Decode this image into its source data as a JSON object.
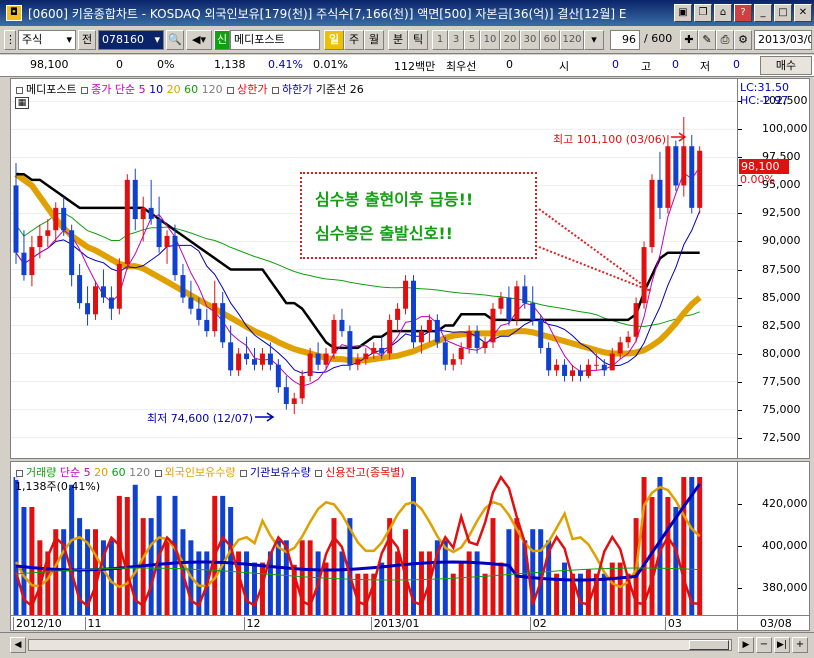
{
  "window": {
    "title": "[0600] 키움종합차트 - KOSDAQ 외국인보유[179(천)] 주식수[7,166(천)] 액면[500] 자본금[36(억)] 결산[12월] E"
  },
  "toolbar": {
    "market_type": "주식",
    "code_label": "전",
    "code": "078160",
    "stock_name_prefix": "신",
    "stock_name": "메디포스트",
    "unit_active": "일",
    "units": [
      "주",
      "월",
      "분",
      "틱"
    ],
    "tick_options": [
      "1",
      "3",
      "5",
      "10",
      "20",
      "30",
      "60",
      "120"
    ],
    "count": "96",
    "count_total": "/ 600",
    "date": "2013/03/0"
  },
  "quote": {
    "price": "98,100",
    "change": "0",
    "change_pct": "0%",
    "volume": "1,138",
    "volume_pct": "0.41%",
    "turnover_pct": "0.01%",
    "amount": "112백만",
    "best_bid_label": "최우선",
    "best_bid": "0",
    "open_label": "시",
    "open": "0",
    "high_label": "고",
    "high": "0",
    "low_label": "저",
    "low": "0",
    "buy_button": "매수"
  },
  "price_legend": {
    "name": "메디포스트",
    "close_ma": "종가 단순",
    "ma_periods": [
      "5",
      "10",
      "20",
      "60",
      "120"
    ],
    "upper_limit": "상한가",
    "lower_limit": "하한가",
    "baseline": "기준선 26"
  },
  "price_axis": {
    "lc": "LC:31.50",
    "hc": "HC:-2.97",
    "current_price": "98,100",
    "current_pct": "0.00%"
  },
  "annotation": {
    "line1": "심수봉 출현이후 급등!!",
    "line2": "심수봉은 출발신호!!",
    "high_label": "최고 101,100 (03/06)",
    "low_label": "최저 74,600 (12/07)"
  },
  "volume_legend": {
    "volume": "거래량",
    "ma": "단순",
    "periods": [
      "5",
      "20",
      "60",
      "120"
    ],
    "foreign": "외국인보유수량",
    "institution": "기관보유수량",
    "credit": "신용잔고(종목별)",
    "current": "1,138주(0.41%)"
  },
  "date_axis": {
    "labels": [
      "2012/10",
      "11",
      "12",
      "2013/01",
      "02",
      "03"
    ],
    "right_label": "03/08"
  },
  "colors": {
    "up": "#e01010",
    "down": "#1040d0",
    "ma5": "#c000c0",
    "ma10": "#0000c0",
    "ma20": "#e0a000",
    "ma60": "#10a010",
    "baseline": "#000000"
  },
  "chart_data": [
    {
      "type": "candlestick",
      "y_ticks": [
        72500,
        75000,
        77500,
        80000,
        82500,
        85000,
        87500,
        90000,
        92500,
        95000,
        97500,
        100000,
        102500
      ],
      "ylim": [
        70500,
        104500
      ],
      "x_months": [
        "2012/10",
        "11",
        "12",
        "2013/01",
        "02",
        "03"
      ],
      "ohlc": [
        [
          95000,
          97000,
          88000,
          89000
        ],
        [
          89000,
          91000,
          86500,
          87000
        ],
        [
          87000,
          90500,
          86000,
          89500
        ],
        [
          89500,
          91500,
          88500,
          90500
        ],
        [
          90500,
          92000,
          89500,
          91000
        ],
        [
          91000,
          93500,
          90000,
          93000
        ],
        [
          93000,
          94000,
          90500,
          91000
        ],
        [
          91000,
          91500,
          86000,
          87000
        ],
        [
          87000,
          88000,
          84000,
          84500
        ],
        [
          84500,
          86000,
          82500,
          83500
        ],
        [
          83500,
          86500,
          83000,
          86000
        ],
        [
          86000,
          87500,
          84500,
          85000
        ],
        [
          85000,
          86000,
          83000,
          84000
        ],
        [
          84000,
          88500,
          83500,
          88000
        ],
        [
          88000,
          96000,
          87500,
          95500
        ],
        [
          95500,
          96500,
          91000,
          92000
        ],
        [
          92000,
          94000,
          90000,
          93000
        ],
        [
          93000,
          95500,
          91500,
          92000
        ],
        [
          92000,
          94000,
          89000,
          89500
        ],
        [
          89500,
          91000,
          88000,
          90500
        ],
        [
          90500,
          91500,
          86500,
          87000
        ],
        [
          87000,
          88000,
          84500,
          85000
        ],
        [
          85000,
          86500,
          83500,
          84000
        ],
        [
          84000,
          85000,
          82500,
          83000
        ],
        [
          83000,
          84000,
          81500,
          82000
        ],
        [
          82000,
          86500,
          81500,
          84500
        ],
        [
          84500,
          85500,
          80500,
          81000
        ],
        [
          81000,
          82500,
          78000,
          78500
        ],
        [
          78500,
          80500,
          78000,
          80000
        ],
        [
          80000,
          81500,
          79000,
          79500
        ],
        [
          79500,
          80500,
          78500,
          79000
        ],
        [
          79000,
          80500,
          78500,
          80000
        ],
        [
          80000,
          81000,
          78500,
          79000
        ],
        [
          79000,
          79500,
          76500,
          77000
        ],
        [
          77000,
          78000,
          75000,
          75500
        ],
        [
          75500,
          76500,
          74600,
          76000
        ],
        [
          76000,
          78500,
          75500,
          78000
        ],
        [
          78000,
          80500,
          77500,
          80000
        ],
        [
          80000,
          81000,
          78500,
          79000
        ],
        [
          79000,
          80500,
          78500,
          80000
        ],
        [
          80000,
          83500,
          79500,
          83000
        ],
        [
          83000,
          84000,
          81500,
          82000
        ],
        [
          82000,
          82500,
          78500,
          79000
        ],
        [
          79000,
          80000,
          78500,
          79500
        ],
        [
          79500,
          80500,
          79000,
          80000
        ],
        [
          80000,
          81000,
          79500,
          80500
        ],
        [
          80500,
          81500,
          79500,
          80000
        ],
        [
          80000,
          83500,
          79500,
          83000
        ],
        [
          83000,
          84500,
          82000,
          84000
        ],
        [
          84000,
          87000,
          83500,
          86500
        ],
        [
          86500,
          87000,
          80500,
          81000
        ],
        [
          81000,
          82500,
          80000,
          82000
        ],
        [
          82000,
          83500,
          81000,
          83000
        ],
        [
          83000,
          83500,
          80500,
          81000
        ],
        [
          81000,
          81500,
          78500,
          79000
        ],
        [
          79000,
          80000,
          78500,
          79500
        ],
        [
          79500,
          81000,
          79000,
          80500
        ],
        [
          80500,
          82500,
          80000,
          82000
        ],
        [
          82000,
          82500,
          80000,
          80500
        ],
        [
          80500,
          81500,
          80000,
          81000
        ],
        [
          81000,
          84500,
          80500,
          84000
        ],
        [
          84000,
          85500,
          83500,
          85000
        ],
        [
          85000,
          86000,
          82500,
          83000
        ],
        [
          83000,
          86500,
          82500,
          86000
        ],
        [
          86000,
          87000,
          84000,
          84500
        ],
        [
          84500,
          86000,
          82500,
          83000
        ],
        [
          83000,
          83500,
          80000,
          80500
        ],
        [
          80500,
          81000,
          78000,
          78500
        ],
        [
          78500,
          79500,
          78000,
          79000
        ],
        [
          79000,
          79500,
          77500,
          78000
        ],
        [
          78000,
          79000,
          77500,
          78500
        ],
        [
          78500,
          79000,
          77500,
          78000
        ],
        [
          78000,
          79500,
          77800,
          79000
        ],
        [
          79000,
          80000,
          78500,
          79000
        ],
        [
          79000,
          79500,
          78000,
          78500
        ],
        [
          78500,
          80500,
          78500,
          80000
        ],
        [
          80000,
          81500,
          79500,
          81000
        ],
        [
          81000,
          82000,
          80500,
          81500
        ],
        [
          81500,
          85000,
          81000,
          84500
        ],
        [
          84500,
          90000,
          84000,
          89500
        ],
        [
          89500,
          96000,
          89000,
          95500
        ],
        [
          95500,
          98000,
          92000,
          93000
        ],
        [
          93000,
          99500,
          92500,
          98500
        ],
        [
          98500,
          99000,
          94500,
          95000
        ],
        [
          95000,
          101100,
          94000,
          98500
        ],
        [
          98500,
          99500,
          92500,
          93000
        ],
        [
          93000,
          98500,
          92500,
          98100
        ]
      ],
      "baseline": [
        96000,
        96000,
        95500,
        95500,
        95000,
        94500,
        94000,
        93500,
        93000,
        93000,
        93000,
        93000,
        93000,
        93000,
        93000,
        93000,
        93000,
        92500,
        92000,
        91500,
        91000,
        90500,
        90000,
        89500,
        89000,
        88500,
        88000,
        87500,
        87500,
        87500,
        87500,
        87500,
        86500,
        85500,
        84500,
        84500,
        84000,
        83000,
        82000,
        81000,
        80500,
        80500,
        80500,
        80500,
        81000,
        81500,
        81500,
        82000,
        82000,
        82000,
        82000,
        82000,
        82000,
        82000,
        82500,
        82500,
        83500,
        83500,
        83500,
        83500,
        83000,
        83000,
        83000,
        83000,
        83000,
        83000,
        83000,
        83000,
        83000,
        83000,
        83000,
        83000,
        83000,
        83000,
        83000,
        83000,
        83000,
        83000,
        83500,
        85500,
        87000,
        88500,
        89000,
        89000,
        89000,
        89000,
        89000
      ],
      "ma20": [
        96000,
        95500,
        95000,
        94000,
        93000,
        92000,
        91200,
        90500,
        90000,
        89500,
        89200,
        88800,
        88400,
        88000,
        87800,
        87800,
        87600,
        87200,
        86800,
        86400,
        86000,
        85600,
        85200,
        84800,
        84400,
        84000,
        83600,
        83200,
        82800,
        82400,
        82000,
        81700,
        81400,
        81000,
        80700,
        80400,
        80200,
        80000,
        79800,
        79600,
        79500,
        79500,
        79400,
        79400,
        79400,
        79500,
        79600,
        79700,
        79800,
        80000,
        80200,
        80500,
        80800,
        81100,
        81400,
        81600,
        81700,
        81800,
        81800,
        81800,
        81800,
        81800,
        81900,
        82000,
        82000,
        81900,
        81700,
        81500,
        81300,
        81100,
        80900,
        80700,
        80500,
        80300,
        80100,
        80000,
        80000,
        80000,
        80100,
        80300,
        80700,
        81200,
        81900,
        82700,
        83600,
        84400,
        85000
      ]
    },
    {
      "type": "bar",
      "y_ticks": [
        380000,
        400000,
        420000
      ],
      "ylim": [
        366000,
        440000
      ]
    }
  ]
}
